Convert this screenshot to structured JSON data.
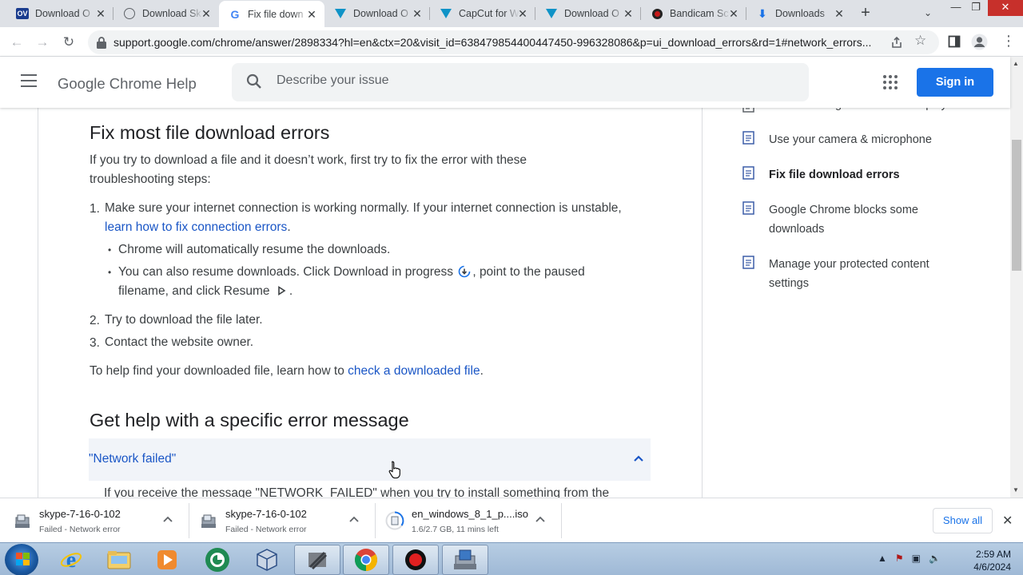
{
  "browser": {
    "tabs": [
      {
        "title": "Download O",
        "favicon": "ov-icon"
      },
      {
        "title": "Download Sk",
        "favicon": "globe-icon"
      },
      {
        "title": "Fix file down",
        "favicon": "google-icon",
        "active": true
      },
      {
        "title": "Download O",
        "favicon": "capcut-icon"
      },
      {
        "title": "CapCut for W",
        "favicon": "capcut-icon"
      },
      {
        "title": "Download O",
        "favicon": "capcut-icon"
      },
      {
        "title": "Bandicam Sc",
        "favicon": "bandicam-icon"
      },
      {
        "title": "Downloads",
        "favicon": "download-icon"
      }
    ],
    "new_tab_label": "+",
    "address": "support.google.com/chrome/answer/2898334?hl=en&ctx=20&visit_id=638479854400447450-996328086&p=ui_download_errors&rd=1#network_errors..."
  },
  "header": {
    "title": "Google Chrome Help",
    "search_placeholder": "Describe your issue",
    "signin_label": "Sign in"
  },
  "article": {
    "heading1": "Fix most file download errors",
    "intro": "If you try to download a file and it doesn’t work, first try to fix the error with these troubleshooting steps:",
    "step1_num": "1.",
    "step1_text_a": "Make sure your internet connection is working normally. If your internet connection is unstable, ",
    "step1_link": "learn how to fix connection errors",
    "step1_text_b": ".",
    "bullet1": "Chrome will automatically resume the downloads.",
    "bullet2_a": "You can also resume downloads. Click Download in progress ",
    "bullet2_b": ", point to the paused filename, and click Resume ",
    "bullet2_c": ".",
    "step2_num": "2.",
    "step2_text": "Try to download the file later.",
    "step3_num": "3.",
    "step3_text": "Contact the website owner.",
    "find_text_a": "To help find your downloaded file, learn how to ",
    "find_link": "check a downloaded file",
    "find_text_b": ".",
    "heading2": "Get help with a specific error message",
    "accordion_title": "\"Network failed\"",
    "accordion_body": "If you receive the message \"NETWORK_FAILED\" when you try to install something from the"
  },
  "sidebar": {
    "partial_item": "Fix videos & games that won't play",
    "items": [
      {
        "label": "Use your camera & microphone"
      },
      {
        "label": "Fix file download errors",
        "current": true
      },
      {
        "label": "Google Chrome blocks some downloads"
      },
      {
        "label": "Manage your protected content settings"
      }
    ]
  },
  "downloads": {
    "items": [
      {
        "name": "skype-7-16-0-102",
        "status": "Failed - Network error"
      },
      {
        "name": "skype-7-16-0-102",
        "status": "Failed - Network error"
      },
      {
        "name": "en_windows_8_1_p....iso",
        "status": "1.6/2.7 GB, 11 mins left"
      }
    ],
    "show_all_label": "Show all"
  },
  "taskbar": {
    "time": "2:59 AM",
    "date": "4/6/2024"
  },
  "colors": {
    "accent": "#1a73e8",
    "link": "#1a56c6",
    "accordion_bg": "#f1f4f9"
  }
}
